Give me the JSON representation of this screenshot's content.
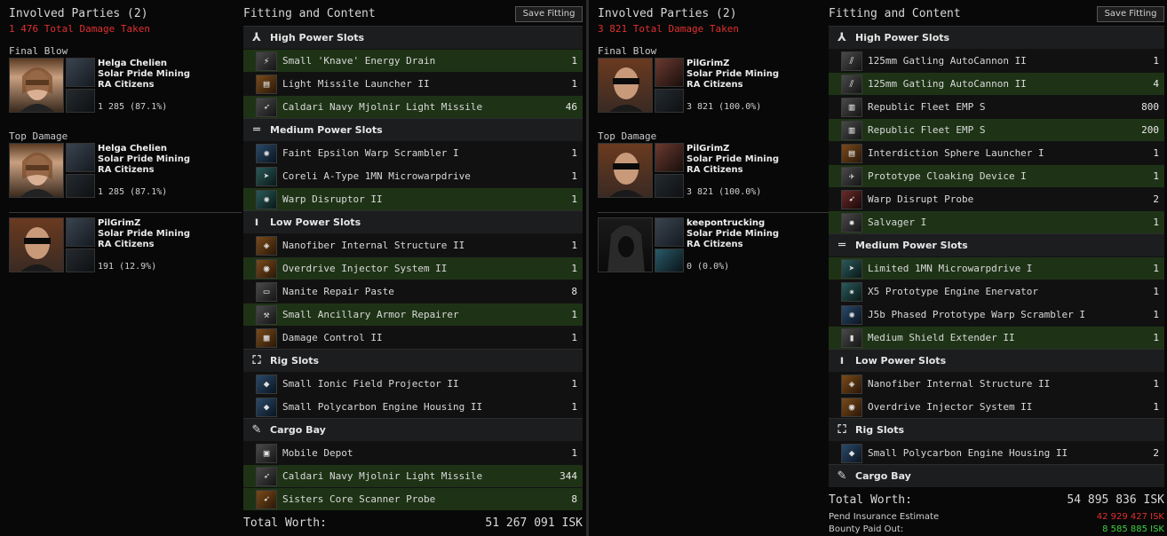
{
  "left": {
    "involved": {
      "title": "Involved Parties (2)",
      "damage_taken": "1 476 Total Damage Taken",
      "final_blow_label": "Final Blow",
      "top_damage_label": "Top Damage",
      "final_blow": {
        "name": "Helga Chelien",
        "corp": "Solar Pride Mining",
        "alliance": "RA Citizens",
        "damage": "1 285 (87.1%)"
      },
      "top_damage": {
        "name": "Helga Chelien",
        "corp": "Solar Pride Mining",
        "alliance": "RA Citizens",
        "damage": "1 285 (87.1%)"
      },
      "others": [
        {
          "name": "PilGrimZ",
          "corp": "Solar Pride Mining",
          "alliance": "RA Citizens",
          "damage": "191 (12.9%)"
        }
      ]
    },
    "fitting": {
      "title": "Fitting and Content",
      "save_label": "Save Fitting",
      "sections": [
        {
          "header": "High Power Slots",
          "icon": "high-slot-icon",
          "glyph": "⅄",
          "items": [
            {
              "name": "Small 'Knave' Energy Drain",
              "qty": "1",
              "style": "green",
              "icon": "energy-drain-icon",
              "glyph": "⚡",
              "color": "bg-grey"
            },
            {
              "name": "Light Missile Launcher II",
              "qty": "1",
              "style": "dark",
              "icon": "missile-launcher-icon",
              "glyph": "▤",
              "color": "bg-orange"
            },
            {
              "name": "Caldari Navy Mjolnir Light Missile",
              "qty": "46",
              "style": "green",
              "icon": "missile-icon",
              "glyph": "➶",
              "color": "bg-grey"
            }
          ]
        },
        {
          "header": "Medium Power Slots",
          "icon": "mid-slot-icon",
          "glyph": "═",
          "items": [
            {
              "name": "Faint Epsilon Warp Scrambler I",
              "qty": "1",
              "style": "dark",
              "icon": "warp-scrambler-icon",
              "glyph": "✺",
              "color": "bg-blue"
            },
            {
              "name": "Coreli A-Type 1MN Microwarpdrive",
              "qty": "1",
              "style": "dark",
              "icon": "microwarpdrive-icon",
              "glyph": "➤",
              "color": "bg-teal"
            },
            {
              "name": "Warp Disruptor II",
              "qty": "1",
              "style": "green",
              "icon": "warp-disruptor-icon",
              "glyph": "✺",
              "color": "bg-teal"
            }
          ]
        },
        {
          "header": "Low Power Slots",
          "icon": "low-slot-icon",
          "glyph": "ı",
          "items": [
            {
              "name": "Nanofiber Internal Structure II",
              "qty": "1",
              "style": "dark",
              "icon": "nanofiber-icon",
              "glyph": "◈",
              "color": "bg-orange"
            },
            {
              "name": "Overdrive Injector System II",
              "qty": "1",
              "style": "green",
              "icon": "overdrive-icon",
              "glyph": "◉",
              "color": "bg-orange"
            },
            {
              "name": "Nanite Repair Paste",
              "qty": "8",
              "style": "dark",
              "icon": "nanite-paste-icon",
              "glyph": "▭",
              "color": "bg-grey"
            },
            {
              "name": "Small Ancillary Armor Repairer",
              "qty": "1",
              "style": "green",
              "icon": "armor-repairer-icon",
              "glyph": "⚒",
              "color": "bg-grey"
            },
            {
              "name": "Damage Control II",
              "qty": "1",
              "style": "dark",
              "icon": "damage-control-icon",
              "glyph": "▦",
              "color": "bg-orange"
            }
          ]
        },
        {
          "header": "Rig Slots",
          "icon": "rig-slot-icon",
          "glyph": "⛶",
          "items": [
            {
              "name": "Small Ionic Field Projector II",
              "qty": "1",
              "style": "dark",
              "icon": "ionic-field-rig-icon",
              "glyph": "◆",
              "color": "bg-blue"
            },
            {
              "name": "Small Polycarbon Engine Housing II",
              "qty": "1",
              "style": "dark",
              "icon": "polycarbon-rig-icon",
              "glyph": "◆",
              "color": "bg-blue"
            }
          ]
        },
        {
          "header": "Cargo Bay",
          "icon": "cargo-bay-icon",
          "glyph": "✎",
          "items": [
            {
              "name": "Mobile Depot",
              "qty": "1",
              "style": "dark",
              "icon": "mobile-depot-icon",
              "glyph": "▣",
              "color": "bg-grey"
            },
            {
              "name": "Caldari Navy Mjolnir Light Missile",
              "qty": "344",
              "style": "green",
              "icon": "missile-icon",
              "glyph": "➶",
              "color": "bg-grey"
            },
            {
              "name": "Sisters Core Scanner Probe",
              "qty": "8",
              "style": "green",
              "icon": "scanner-probe-icon",
              "glyph": "➹",
              "color": "bg-orange"
            }
          ]
        }
      ],
      "total_worth_label": "Total Worth:",
      "total_worth_value": "51 267 091 ISK"
    }
  },
  "right": {
    "involved": {
      "title": "Involved Parties (2)",
      "damage_taken": "3 821 Total Damage Taken",
      "final_blow_label": "Final Blow",
      "top_damage_label": "Top Damage",
      "final_blow": {
        "name": "PilGrimZ",
        "corp": "Solar Pride Mining",
        "alliance": "RA Citizens",
        "damage": "3 821 (100.0%)"
      },
      "top_damage": {
        "name": "PilGrimZ",
        "corp": "Solar Pride Mining",
        "alliance": "RA Citizens",
        "damage": "3 821 (100.0%)"
      },
      "others": [
        {
          "name": "keepontrucking",
          "corp": "Solar Pride Mining",
          "alliance": "RA Citizens",
          "damage": "0 (0.0%)"
        }
      ]
    },
    "fitting": {
      "title": "Fitting and Content",
      "save_label": "Save Fitting",
      "sections": [
        {
          "header": "High Power Slots",
          "icon": "high-slot-icon",
          "glyph": "⅄",
          "items": [
            {
              "name": "125mm Gatling AutoCannon II",
              "qty": "1",
              "style": "dark",
              "icon": "autocannon-icon",
              "glyph": "⫽",
              "color": "bg-grey"
            },
            {
              "name": "125mm Gatling AutoCannon II",
              "qty": "4",
              "style": "green",
              "icon": "autocannon-icon",
              "glyph": "⫽",
              "color": "bg-grey"
            },
            {
              "name": "Republic Fleet EMP S",
              "qty": "800",
              "style": "dark",
              "icon": "emp-ammo-icon",
              "glyph": "▥",
              "color": "bg-grey"
            },
            {
              "name": "Republic Fleet EMP S",
              "qty": "200",
              "style": "green",
              "icon": "emp-ammo-icon",
              "glyph": "▥",
              "color": "bg-grey"
            },
            {
              "name": "Interdiction Sphere Launcher I",
              "qty": "1",
              "style": "dark",
              "icon": "interdiction-launcher-icon",
              "glyph": "▤",
              "color": "bg-orange"
            },
            {
              "name": "Prototype Cloaking Device I",
              "qty": "1",
              "style": "green",
              "icon": "cloak-icon",
              "glyph": "✈",
              "color": "bg-grey"
            },
            {
              "name": "Warp Disrupt Probe",
              "qty": "2",
              "style": "dark",
              "icon": "disrupt-probe-icon",
              "glyph": "➹",
              "color": "bg-red"
            },
            {
              "name": "Salvager I",
              "qty": "1",
              "style": "green",
              "icon": "salvager-icon",
              "glyph": "✹",
              "color": "bg-grey"
            }
          ]
        },
        {
          "header": "Medium Power Slots",
          "icon": "mid-slot-icon",
          "glyph": "═",
          "items": [
            {
              "name": "Limited 1MN Microwarpdrive I",
              "qty": "1",
              "style": "green",
              "icon": "microwarpdrive-icon",
              "glyph": "➤",
              "color": "bg-teal"
            },
            {
              "name": "X5 Prototype Engine Enervator",
              "qty": "1",
              "style": "dark",
              "icon": "web-icon",
              "glyph": "✷",
              "color": "bg-teal"
            },
            {
              "name": "J5b Phased Prototype Warp Scrambler I",
              "qty": "1",
              "style": "dark",
              "icon": "warp-scrambler-icon",
              "glyph": "✺",
              "color": "bg-blue"
            },
            {
              "name": "Medium Shield Extender II",
              "qty": "1",
              "style": "green",
              "icon": "shield-extender-icon",
              "glyph": "▮",
              "color": "bg-grey"
            }
          ]
        },
        {
          "header": "Low Power Slots",
          "icon": "low-slot-icon",
          "glyph": "ı",
          "items": [
            {
              "name": "Nanofiber Internal Structure II",
              "qty": "1",
              "style": "dark",
              "icon": "nanofiber-icon",
              "glyph": "◈",
              "color": "bg-orange"
            },
            {
              "name": "Overdrive Injector System II",
              "qty": "1",
              "style": "dark",
              "icon": "overdrive-icon",
              "glyph": "◉",
              "color": "bg-orange"
            }
          ]
        },
        {
          "header": "Rig Slots",
          "icon": "rig-slot-icon",
          "glyph": "⛶",
          "items": [
            {
              "name": "Small Polycarbon Engine Housing II",
              "qty": "2",
              "style": "dark",
              "icon": "polycarbon-rig-icon",
              "glyph": "◆",
              "color": "bg-blue"
            }
          ]
        },
        {
          "header": "Cargo Bay",
          "icon": "cargo-bay-icon",
          "glyph": "✎",
          "items": []
        }
      ],
      "total_worth_label": "Total Worth:",
      "total_worth_value": "54 895 836 ISK",
      "pend_insurance_label": "Pend Insurance Estimate",
      "pend_insurance_value": "42 929 427 ISK",
      "bounty_label": "Bounty Paid Out:",
      "bounty_value": "8 585 885 ISK"
    }
  }
}
